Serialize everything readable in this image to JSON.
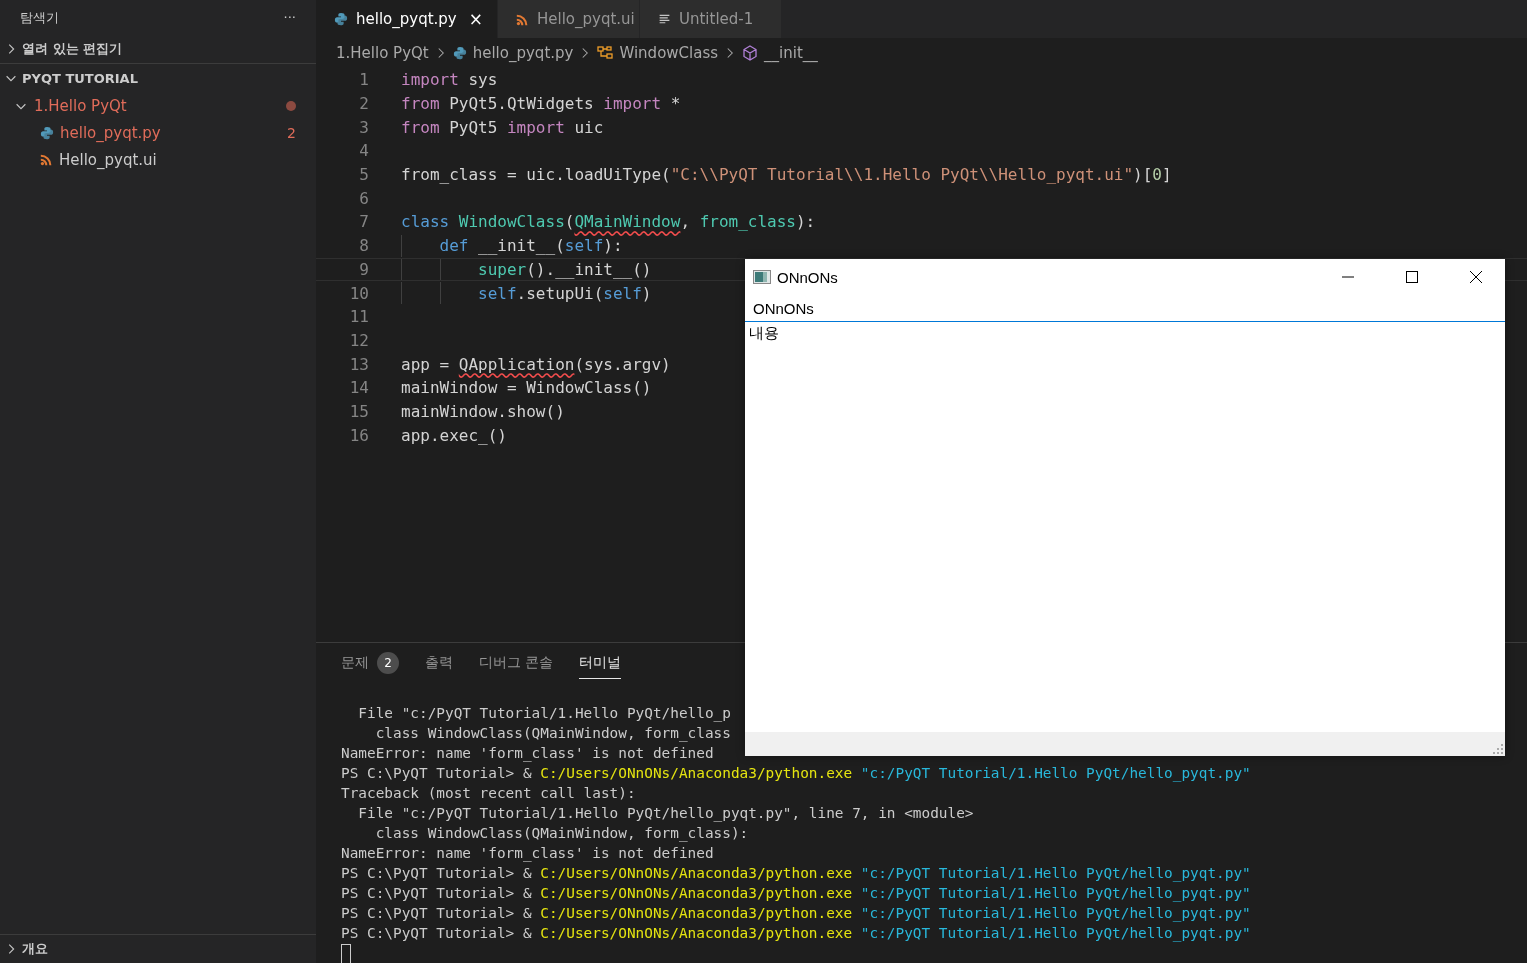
{
  "sidebar": {
    "title": "탐색기",
    "more": "···",
    "sections": [
      {
        "label": "열려 있는 편집기",
        "expanded": false
      },
      {
        "label": "PYQT TUTORIAL",
        "expanded": true,
        "children": [
          {
            "label": "1.Hello PyQt",
            "kind": "folder",
            "expanded": true,
            "modified": true,
            "children": [
              {
                "label": "hello_pyqt.py",
                "kind": "python",
                "modified": true,
                "count": "2"
              },
              {
                "label": "Hello_pyqt.ui",
                "kind": "rss",
                "modified": false
              }
            ]
          }
        ]
      }
    ],
    "outline": {
      "label": "개요",
      "expanded": false
    }
  },
  "tabs": [
    {
      "label": "hello_pyqt.py",
      "kind": "python",
      "selected": true,
      "close": "×"
    },
    {
      "label": "Hello_pyqt.ui",
      "kind": "rss",
      "selected": false
    },
    {
      "label": "Untitled-1",
      "kind": "text",
      "selected": false
    }
  ],
  "breadcrumb": [
    {
      "label": "1.Hello PyQt",
      "kind": "folder"
    },
    {
      "label": "hello_pyqt.py",
      "kind": "python"
    },
    {
      "label": "WindowClass",
      "kind": "class"
    },
    {
      "label": "__init__",
      "kind": "method"
    }
  ],
  "code": [
    {
      "number": "1",
      "tokens": [
        {
          "text": "import",
          "kind": "kw"
        },
        {
          "text": " sys",
          "kind": "plain"
        }
      ]
    },
    {
      "number": "2",
      "tokens": [
        {
          "text": "from",
          "kind": "kw"
        },
        {
          "text": " PyQt5.QtWidgets ",
          "kind": "plain"
        },
        {
          "text": "import",
          "kind": "kw"
        },
        {
          "text": " *",
          "kind": "plain"
        }
      ]
    },
    {
      "number": "3",
      "tokens": [
        {
          "text": "from",
          "kind": "kw"
        },
        {
          "text": " PyQt5 ",
          "kind": "plain"
        },
        {
          "text": "import",
          "kind": "kw"
        },
        {
          "text": " uic",
          "kind": "plain"
        }
      ]
    },
    {
      "number": "4"
    },
    {
      "number": "5",
      "tokens": [
        {
          "text": "from_class = uic.loadUiType(",
          "kind": "plain"
        },
        {
          "text": "\"C:\\\\PyQT Tutorial\\\\1.Hello PyQt\\\\Hello_pyqt.ui\"",
          "kind": "str"
        },
        {
          "text": ")[",
          "kind": "plain"
        },
        {
          "text": "0",
          "kind": "num"
        },
        {
          "text": "]",
          "kind": "plain"
        }
      ]
    },
    {
      "number": "6"
    },
    {
      "number": "7",
      "tokens": [
        {
          "text": "class ",
          "kind": "def"
        },
        {
          "text": "WindowClass",
          "kind": "cls"
        },
        {
          "text": "(",
          "kind": "plain"
        },
        {
          "text": "QMainWindow",
          "kind": "cls",
          "squiggle": true
        },
        {
          "text": ", ",
          "kind": "plain"
        },
        {
          "text": "from_class",
          "kind": "cls"
        },
        {
          "text": "):",
          "kind": "plain"
        }
      ],
      "children": [
        {
          "number": "8",
          "tokens": [
            {
              "text": "def",
              "kind": "def"
            },
            {
              "text": " __init__(",
              "kind": "plain"
            },
            {
              "text": "self",
              "kind": "def"
            },
            {
              "text": "):",
              "kind": "plain"
            }
          ],
          "children": [
            {
              "number": "9",
              "current": true,
              "tokens": [
                {
                  "text": "super",
                  "kind": "cls"
                },
                {
                  "text": "().__init__()",
                  "kind": "plain"
                }
              ]
            },
            {
              "number": "10",
              "tokens": [
                {
                  "text": "self",
                  "kind": "def"
                },
                {
                  "text": ".setupUi(",
                  "kind": "plain"
                },
                {
                  "text": "self",
                  "kind": "def"
                },
                {
                  "text": ")",
                  "kind": "plain"
                }
              ]
            }
          ]
        }
      ]
    },
    {
      "number": "11"
    },
    {
      "number": "12"
    },
    {
      "number": "13",
      "tokens": [
        {
          "text": "app = ",
          "kind": "plain"
        },
        {
          "text": "QApplication",
          "kind": "plain",
          "squiggle": true
        },
        {
          "text": "(sys.argv)",
          "kind": "plain"
        }
      ]
    },
    {
      "number": "14",
      "tokens": [
        {
          "text": "mainWindow = WindowClass()",
          "kind": "plain"
        }
      ]
    },
    {
      "number": "15",
      "tokens": [
        {
          "text": "mainWindow.show()",
          "kind": "plain"
        }
      ]
    },
    {
      "number": "16",
      "tokens": [
        {
          "text": "app.exec_()",
          "kind": "plain"
        }
      ]
    }
  ],
  "panel_tabs": [
    {
      "label": "문제",
      "badge": "2",
      "selected": false
    },
    {
      "label": "출력",
      "selected": false
    },
    {
      "label": "디버그 콘솔",
      "selected": false
    },
    {
      "label": "터미널",
      "selected": true
    }
  ],
  "terminal": [
    [
      {
        "text": "  File \"c:/PyQT Tutorial/1.Hello PyQt/hello_p",
        "kind": "plain"
      }
    ],
    [
      {
        "text": "    class WindowClass(QMainWindow, form_class",
        "kind": "plain"
      }
    ],
    [
      {
        "text": "NameError: name 'form_class' is not defined",
        "kind": "plain"
      }
    ],
    [
      {
        "text": "PS C:\\PyQT Tutorial> & ",
        "kind": "plain"
      },
      {
        "text": "C:/Users/ONnONs/Anaconda3/python.exe",
        "kind": "path"
      },
      {
        "text": " \"c:/PyQT Tutorial/1.Hello PyQt/hello_pyqt.py\"",
        "kind": "str"
      }
    ],
    [
      {
        "text": "Traceback (most recent call last):",
        "kind": "plain"
      }
    ],
    [
      {
        "text": "  File \"c:/PyQT Tutorial/1.Hello PyQt/hello_pyqt.py\", line 7, in <module>",
        "kind": "plain"
      }
    ],
    [
      {
        "text": "    class WindowClass(QMainWindow, form_class):",
        "kind": "plain"
      }
    ],
    [
      {
        "text": "NameError: name 'form_class' is not defined",
        "kind": "plain"
      }
    ],
    [
      {
        "text": "PS C:\\PyQT Tutorial> & ",
        "kind": "plain"
      },
      {
        "text": "C:/Users/ONnONs/Anaconda3/python.exe",
        "kind": "path"
      },
      {
        "text": " \"c:/PyQT Tutorial/1.Hello PyQt/hello_pyqt.py\"",
        "kind": "str"
      }
    ],
    [
      {
        "text": "PS C:\\PyQT Tutorial> & ",
        "kind": "plain"
      },
      {
        "text": "C:/Users/ONnONs/Anaconda3/python.exe",
        "kind": "path"
      },
      {
        "text": " \"c:/PyQT Tutorial/1.Hello PyQt/hello_pyqt.py\"",
        "kind": "str"
      }
    ],
    [
      {
        "text": "PS C:\\PyQT Tutorial> & ",
        "kind": "plain"
      },
      {
        "text": "C:/Users/ONnONs/Anaconda3/python.exe",
        "kind": "path"
      },
      {
        "text": " \"c:/PyQT Tutorial/1.Hello PyQt/hello_pyqt.py\"",
        "kind": "str"
      }
    ],
    [
      {
        "text": "PS C:\\PyQT Tutorial> & ",
        "kind": "plain"
      },
      {
        "text": "C:/Users/ONnONs/Anaconda3/python.exe",
        "kind": "path"
      },
      {
        "text": " \"c:/PyQT Tutorial/1.Hello PyQt/hello_pyqt.py\"",
        "kind": "str"
      }
    ]
  ],
  "qt_window": {
    "title": "ONnONs",
    "menu": "ONnONs",
    "content": "내용"
  }
}
